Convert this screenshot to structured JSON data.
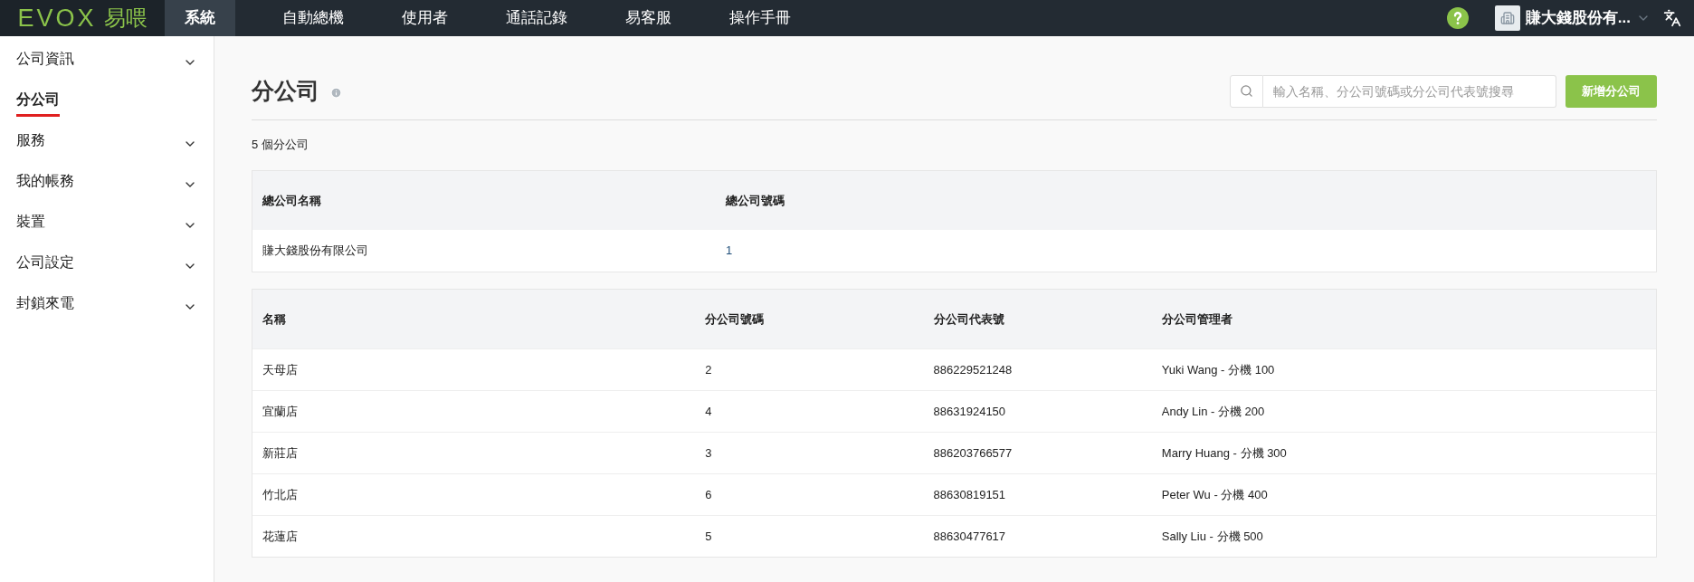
{
  "topbar": {
    "logo": {
      "wordmark": "EVOX",
      "name": "易喂"
    },
    "nav": [
      {
        "label": "系統",
        "selected": true
      },
      {
        "label": "自動總機",
        "selected": false
      },
      {
        "label": "使用者",
        "selected": false
      },
      {
        "label": "通話記錄",
        "selected": false
      },
      {
        "label": "易客服",
        "selected": false
      },
      {
        "label": "操作手冊",
        "selected": false
      }
    ],
    "account": "賺大錢股份有..."
  },
  "sidebar": {
    "items": [
      {
        "label": "公司資訊",
        "kind": "group",
        "selected": false
      },
      {
        "label": "分公司",
        "kind": "link",
        "selected": true
      },
      {
        "label": "服務",
        "kind": "group",
        "selected": false
      },
      {
        "label": "我的帳務",
        "kind": "group",
        "selected": false
      },
      {
        "label": "裝置",
        "kind": "group",
        "selected": false
      },
      {
        "label": "公司設定",
        "kind": "group",
        "selected": false
      },
      {
        "label": "封鎖來電",
        "kind": "group",
        "selected": false
      }
    ]
  },
  "page": {
    "title": "分公司",
    "search": {
      "placeholder": "輸入名稱、分公司號碼或分公司代表號搜尋"
    },
    "add_button": "新增分公司",
    "count": "5 個分公司"
  },
  "hq_table": {
    "columns": [
      "總公司名稱",
      "總公司號碼"
    ],
    "rows": [
      [
        "賺大錢股份有限公司",
        "1"
      ]
    ]
  },
  "branch_table": {
    "columns": [
      "名稱",
      "分公司號碼",
      "分公司代表號",
      "分公司管理者"
    ],
    "rows": [
      [
        "天母店",
        "2",
        "886229521248",
        "Yuki Wang - 分機 100"
      ],
      [
        "宜蘭店",
        "4",
        "88631924150",
        "Andy Lin - 分機 200"
      ],
      [
        "新莊店",
        "3",
        "886203766577",
        "Marry Huang - 分機 300"
      ],
      [
        "竹北店",
        "6",
        "88630819151",
        "Peter Wu - 分機 400"
      ],
      [
        "花蓮店",
        "5",
        "88630477617",
        "Sally Liu - 分機 500"
      ]
    ]
  }
}
